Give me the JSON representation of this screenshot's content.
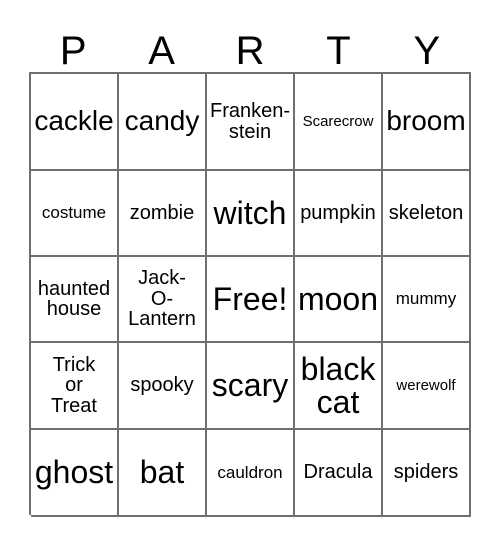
{
  "card": {
    "title_letters": [
      "P",
      "A",
      "R",
      "T",
      "Y"
    ],
    "border_color": "#6f6f6f",
    "text_color": "#000000",
    "background_color": "#ffffff",
    "columns": 5,
    "rows": 5,
    "free_space_label": "Free!",
    "free_space_position": {
      "row": 3,
      "column": 3
    }
  },
  "grid": {
    "rows": [
      {
        "cells": [
          {
            "text": "cackle",
            "size": "fs-xl"
          },
          {
            "text": "candy",
            "size": "fs-xl"
          },
          {
            "text": "Franken-\nstein",
            "size": "fs-m"
          },
          {
            "text": "Scarecrow",
            "size": "fs-xs"
          },
          {
            "text": "broom",
            "size": "fs-xl"
          }
        ]
      },
      {
        "cells": [
          {
            "text": "costume",
            "size": "fs-s"
          },
          {
            "text": "zombie",
            "size": "fs-m"
          },
          {
            "text": "witch",
            "size": "fs-xxl"
          },
          {
            "text": "pumpkin",
            "size": "fs-m"
          },
          {
            "text": "skeleton",
            "size": "fs-m"
          }
        ]
      },
      {
        "cells": [
          {
            "text": "haunted\nhouse",
            "size": "fs-m"
          },
          {
            "text": "Jack-\nO-\nLantern",
            "size": "fs-m"
          },
          {
            "text": "Free!",
            "size": "fs-xxl"
          },
          {
            "text": "moon",
            "size": "fs-xxl"
          },
          {
            "text": "mummy",
            "size": "fs-s"
          }
        ]
      },
      {
        "cells": [
          {
            "text": "Trick\nor\nTreat",
            "size": "fs-m"
          },
          {
            "text": "spooky",
            "size": "fs-m"
          },
          {
            "text": "scary",
            "size": "fs-xxl"
          },
          {
            "text": "black\ncat",
            "size": "fs-xxl"
          },
          {
            "text": "werewolf",
            "size": "fs-xs"
          }
        ]
      },
      {
        "cells": [
          {
            "text": "ghost",
            "size": "fs-xxl"
          },
          {
            "text": "bat",
            "size": "fs-xxl"
          },
          {
            "text": "cauldron",
            "size": "fs-s"
          },
          {
            "text": "Dracula",
            "size": "fs-m"
          },
          {
            "text": "spiders",
            "size": "fs-m"
          }
        ]
      }
    ]
  }
}
